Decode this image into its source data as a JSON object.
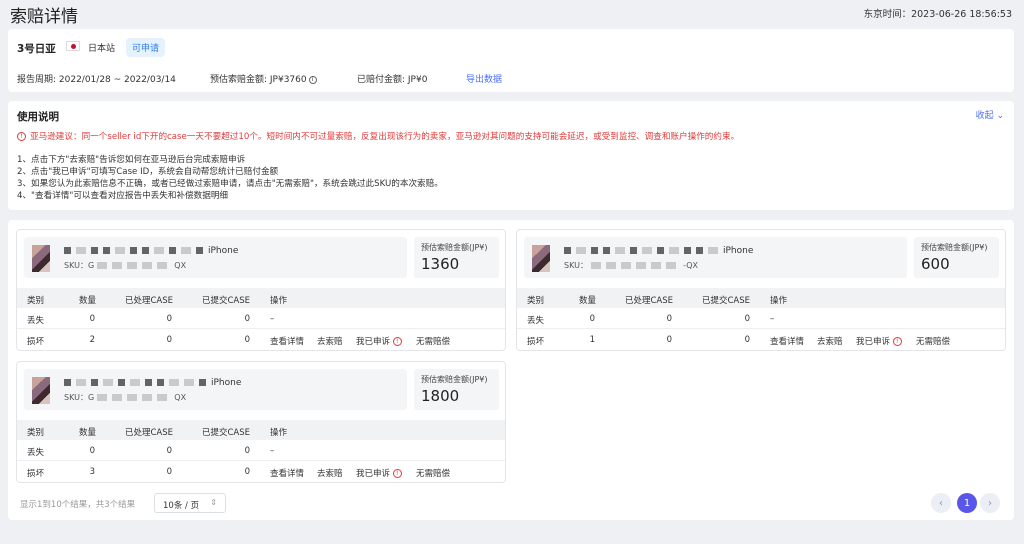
{
  "header": {
    "title": "索赔详情",
    "time_label": "东京时间：2023-06-26 18:56:53"
  },
  "store": {
    "name": "3号日亚",
    "site": "日本站",
    "badge": "可申请",
    "report_period": "报告周期: 2022/01/28 ~ 2022/03/14",
    "estimated": "预估索赔金额: JP¥3760",
    "paid": "已赔付金额: JP¥0",
    "export": "导出数据"
  },
  "instructions": {
    "title": "使用说明",
    "collapse": "收起",
    "warning": "亚马逊建议：同一个seller id下开的case一天不要超过10个。短时间内不可过量索赔，反复出现该行为的卖家，亚马逊对其问题的支持可能会延迟，或受到监控、调查和账户操作的约束。",
    "items": [
      "1、点击下方\"去索赔\"告诉您如何在亚马逊后台完成索赔申诉",
      "2、点击\"我已申诉\"可填写Case ID，系统会自动帮您统计已赔付金额",
      "3、如果您认为此索赔信息不正确，或者已经做过索赔申请，请点击\"无需索赔\"，系统会跳过此SKU的本次索赔。",
      "4、\"查看详情\"可以查看对应报告中丢失和补偿数据明细"
    ]
  },
  "table_headers": {
    "type": "类别",
    "qty": "数量",
    "processed": "已处理CASE",
    "submitted": "已提交CASE",
    "action": "操作"
  },
  "products": [
    {
      "name_visible": "iPhone",
      "sku_label": "SKU：",
      "sku_prefix": "G",
      "sku_suffix": "QX",
      "est_label": "预估索赔金额(JP¥)",
      "est_value": "1360",
      "rows": [
        {
          "type": "丢失",
          "qty": "0",
          "processed": "0",
          "submitted": "0",
          "action_dash": "–"
        },
        {
          "type": "损坏",
          "qty": "2",
          "processed": "0",
          "submitted": "0"
        }
      ]
    },
    {
      "name_visible": "iPhone",
      "sku_label": "SKU：",
      "sku_prefix": "",
      "sku_suffix": "-QX",
      "est_label": "预估索赔金额(JP¥)",
      "est_value": "600",
      "rows": [
        {
          "type": "丢失",
          "qty": "0",
          "processed": "0",
          "submitted": "0",
          "action_dash": "–"
        },
        {
          "type": "损坏",
          "qty": "1",
          "processed": "0",
          "submitted": "0"
        }
      ]
    },
    {
      "name_visible": "iPhone",
      "sku_label": "SKU：",
      "sku_prefix": "G",
      "sku_suffix": "QX",
      "est_label": "预估索赔金额(JP¥)",
      "est_value": "1800",
      "rows": [
        {
          "type": "丢失",
          "qty": "0",
          "processed": "0",
          "submitted": "0",
          "action_dash": "–"
        },
        {
          "type": "损坏",
          "qty": "3",
          "processed": "0",
          "submitted": "0"
        }
      ]
    }
  ],
  "actions": {
    "view": "查看详情",
    "claim": "去索赔",
    "appealed": "我已申诉",
    "no_claim": "无需赔偿"
  },
  "pagination": {
    "summary": "显示1到10个结果，共3个结果",
    "page_size": "10条 / 页",
    "current": "1",
    "prev": "‹",
    "next": "›"
  },
  "colors": {
    "accent": "#4b6ff5",
    "warning": "#e03a3a",
    "badge_bg": "#e5f1fd"
  }
}
